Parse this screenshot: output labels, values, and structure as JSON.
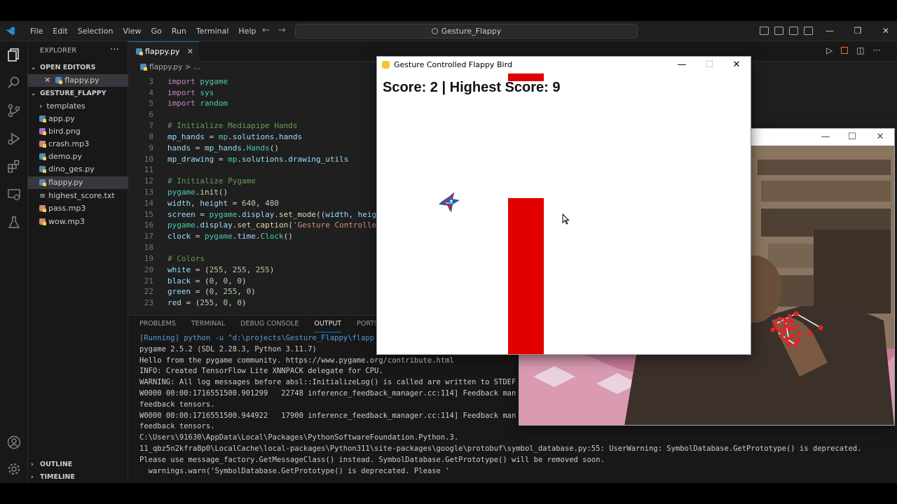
{
  "vscode": {
    "menu": [
      "File",
      "Edit",
      "Selection",
      "View",
      "Go",
      "Run",
      "Terminal",
      "Help"
    ],
    "search_text": "Gesture_Flappy",
    "explorer": {
      "header": "EXPLORER",
      "open_editors_title": "OPEN EDITORS",
      "open_editor_file": "flappy.py",
      "project_title": "GESTURE_FLAPPY",
      "files": [
        "templates",
        "app.py",
        "bird.png",
        "crash.mp3",
        "demo.py",
        "dino_ges.py",
        "flappy.py",
        "highest_score.txt",
        "pass.mp3",
        "wow.mp3"
      ],
      "outline_title": "OUTLINE",
      "timeline_title": "TIMELINE"
    },
    "tab_label": "flappy.py",
    "breadcrumb": "flappy.py > ...",
    "code_lines": [
      {
        "n": "3",
        "text": "import pygame"
      },
      {
        "n": "4",
        "text": "import sys"
      },
      {
        "n": "5",
        "text": "import random"
      },
      {
        "n": "6",
        "text": ""
      },
      {
        "n": "7",
        "text": "# Initialize Mediapipe Hands"
      },
      {
        "n": "8",
        "text": "mp_hands = mp.solutions.hands"
      },
      {
        "n": "9",
        "text": "hands = mp_hands.Hands()"
      },
      {
        "n": "10",
        "text": "mp_drawing = mp.solutions.drawing_utils"
      },
      {
        "n": "11",
        "text": ""
      },
      {
        "n": "12",
        "text": "# Initialize Pygame"
      },
      {
        "n": "13",
        "text": "pygame.init()"
      },
      {
        "n": "14",
        "text": "width, height = 640, 480"
      },
      {
        "n": "15",
        "text": "screen = pygame.display.set_mode((width, heigh"
      },
      {
        "n": "16",
        "text": "pygame.display.set_caption('Gesture Controlled"
      },
      {
        "n": "17",
        "text": "clock = pygame.time.Clock()"
      },
      {
        "n": "18",
        "text": ""
      },
      {
        "n": "19",
        "text": "# Colors"
      },
      {
        "n": "20",
        "text": "white = (255, 255, 255)"
      },
      {
        "n": "21",
        "text": "black = (0, 0, 0)"
      },
      {
        "n": "22",
        "text": "green = (0, 255, 0)"
      },
      {
        "n": "23",
        "text": "red = (255, 0, 0)"
      }
    ],
    "panel_tabs": [
      "PROBLEMS",
      "TERMINAL",
      "DEBUG CONSOLE",
      "OUTPUT",
      "PORTS"
    ],
    "active_panel_tab": "OUTPUT",
    "output_lines": [
      "[Running] python -u \"d:\\projects\\Gesture_Flappy\\flapp",
      "pygame 2.5.2 (SDL 2.28.3, Python 3.11.7)",
      "Hello from the pygame community. https://www.pygame.org/contribute.html",
      "INFO: Created TensorFlow Lite XNNPACK delegate for CPU.",
      "WARNING: All log messages before absl::InitializeLog() is called are written to STDEF",
      "W0000 00:00:1716551500.901299   22748 inference_feedback_manager.cc:114] Feedback man",
      "feedback tensors.",
      "W0000 00:00:1716551500.944922   17900 inference_feedback_manager.cc:114] Feedback man",
      "feedback tensors.",
      "C:\\Users\\91630\\AppData\\Local\\Packages\\PythonSoftwareFoundation.Python.3.",
      "11_qbz5n2kfra8p0\\LocalCache\\local-packages\\Python311\\site-packages\\google\\protobuf\\symbol_database.py:55: UserWarning: SymbolDatabase.GetPrototype() is deprecated.",
      "Please use message_factory.GetMessageClass() instead. SymbolDatabase.GetPrototype() will be removed soon.",
      "  warnings.warn('SymbolDatabase.GetPrototype() is deprecated. Please '"
    ]
  },
  "game_window": {
    "title": "Gesture Controlled Flappy Bird",
    "score_text": "Score: 2 | Highest Score: 9",
    "pipe_color": "#e00000"
  },
  "webcam_window": {
    "landmark_color": "#e3222b"
  },
  "colors": {
    "accent": "#0078d4",
    "editor_bg": "#1f1f1f",
    "sidebar_bg": "#181818"
  }
}
